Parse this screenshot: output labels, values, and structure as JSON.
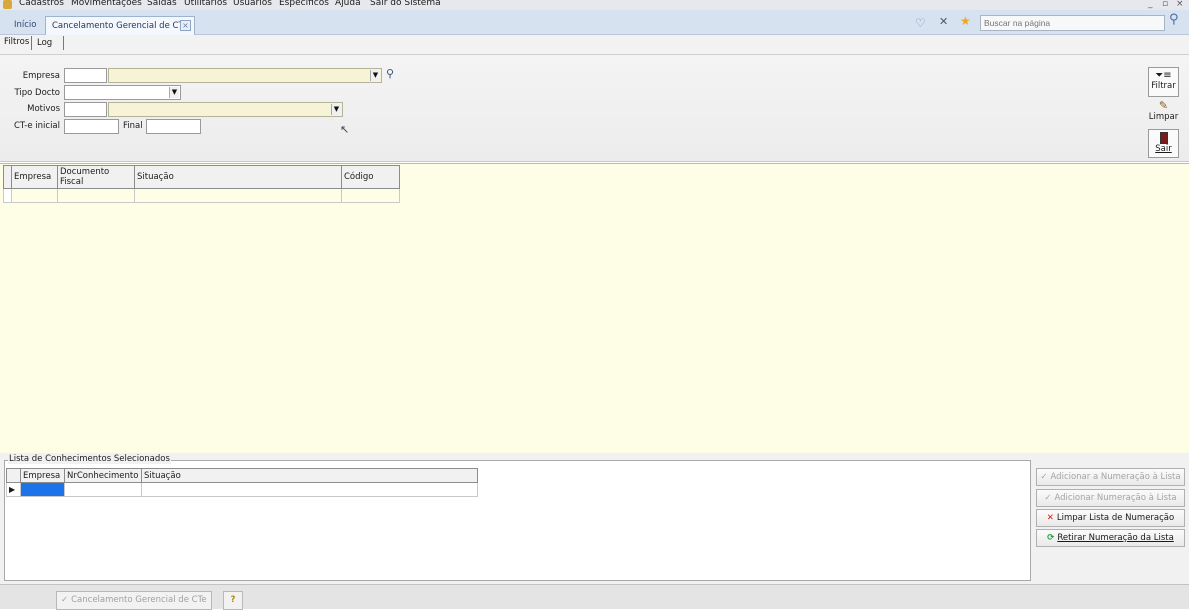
{
  "menu": {
    "items": [
      "Cadastros",
      "Movimentações",
      "Saídas",
      "Utilitários",
      "Usuários",
      "Específicos",
      "Ajuda",
      "Sair do Sistema"
    ],
    "window_controls": [
      "_",
      "▫",
      "×"
    ]
  },
  "tabs": {
    "home_label": "Início",
    "active_label": "Cancelamento Gerencial de CTe",
    "close_glyph": "×"
  },
  "search": {
    "placeholder": "Buscar na página",
    "value": ""
  },
  "inner_tabs": [
    "Filtros",
    "Log"
  ],
  "filters": {
    "empresa_label": "Empresa",
    "tipo_docto_label": "Tipo Docto",
    "motivos_label": "Motivos",
    "cte_inicial_label": "CT-e inicial",
    "final_label": "Final",
    "empresa_code": "",
    "empresa_name": "",
    "tipo_docto": "",
    "motivo_code": "",
    "motivo_name": "",
    "cte_inicial": "",
    "cte_final": ""
  },
  "side_buttons": {
    "filtrar": "Filtrar",
    "limpar": "Limpar",
    "sair": "Sair"
  },
  "main_grid": {
    "columns": [
      "Empresa",
      "Documento Fiscal",
      "Situação",
      "Código"
    ]
  },
  "selected_list": {
    "title": "Lista de Conhecimentos Selecionados",
    "columns": [
      "Empresa",
      "NrConhecimento",
      "Situação"
    ]
  },
  "actions": {
    "add_to_list_top": "Adicionar a Numeração à Lista",
    "add_to_list": "Adicionar Numeração à Lista",
    "clear_list": "Limpar Lista de Numeração",
    "remove_numbering": "Retirar Numeração da Lista"
  },
  "statusbar": {
    "task_label": "Cancelamento Gerencial de CTe",
    "help_glyph": "?"
  },
  "colors": {
    "grid_bg": "#fefde6",
    "tab_bar": "#d6e2ef",
    "selected_cell": "#1e73e8"
  }
}
